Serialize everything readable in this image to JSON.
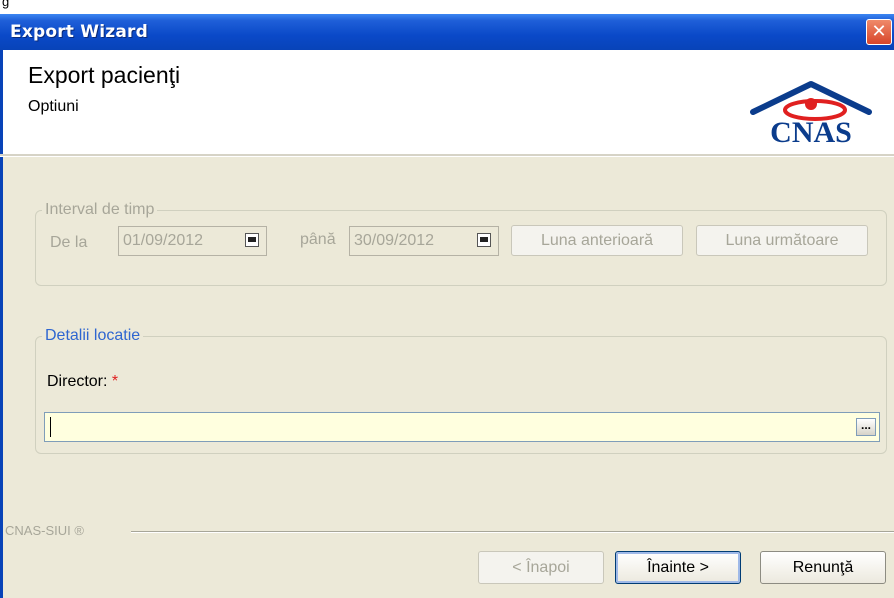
{
  "window": {
    "title": "Export Wizard",
    "close_glyph": "✕"
  },
  "header": {
    "title": "Export pacienţi",
    "subtitle": "Optiuni",
    "logo_text": "CNAS"
  },
  "interval": {
    "legend": "Interval de timp",
    "from_label": "De la",
    "from_value": "01/09/2012",
    "to_label": "până",
    "to_value": "30/09/2012",
    "prev_month_label": "Luna anterioară",
    "next_month_label": "Luna următoare"
  },
  "location": {
    "legend": "Detalii locatie",
    "director_label": "Director:",
    "required_mark": "*",
    "path_value": "",
    "browse_label": "..."
  },
  "footer": {
    "brand": "CNAS-SIUI ®",
    "back_label": "< Înapoi",
    "next_label": "Înainte >",
    "cancel_label": "Renunţă"
  },
  "colors": {
    "titlebar": "#0a49c8",
    "logo": "#0b3c8c",
    "logo_accent": "#e02020",
    "input_bg": "#ffffdf"
  }
}
